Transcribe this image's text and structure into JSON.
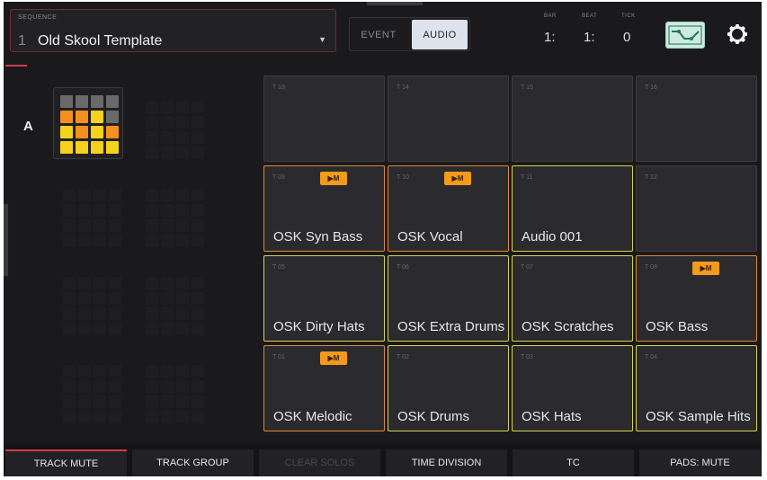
{
  "header": {
    "sequence_label": "SEQUENCE",
    "sequence_number": "1",
    "sequence_name": "Old Skool Template",
    "mode_event": "EVENT",
    "mode_audio": "AUDIO",
    "bar_label": "BAR",
    "bar_value": "1:",
    "beat_label": "BEAT",
    "beat_value": "1:",
    "tick_label": "TICK",
    "tick_value": "0"
  },
  "bank": {
    "label": "A",
    "cells": [
      "#6a6a6a",
      "#6a6a6a",
      "#6a6a6a",
      "#6a6a6a",
      "#f3901e",
      "#f3901e",
      "#f5d21c",
      "#6a6a6a",
      "#f5d21c",
      "#f3901e",
      "#f5d21c",
      "#f3901e",
      "#f5d21c",
      "#f5d21c",
      "#f5d21c",
      "#f5d21c"
    ]
  },
  "pads": [
    {
      "id": "T 13",
      "name": "",
      "border": "none",
      "badge": ""
    },
    {
      "id": "T 14",
      "name": "",
      "border": "none",
      "badge": ""
    },
    {
      "id": "T 15",
      "name": "",
      "border": "none",
      "badge": ""
    },
    {
      "id": "T 16",
      "name": "",
      "border": "none",
      "badge": ""
    },
    {
      "id": "T 09",
      "name": "OSK Syn Bass",
      "border": "orange",
      "badge": "▶M"
    },
    {
      "id": "T 10",
      "name": "OSK Vocal",
      "border": "orange",
      "badge": "▶M"
    },
    {
      "id": "T 11",
      "name": "Audio 001",
      "border": "yellow",
      "badge": ""
    },
    {
      "id": "T 12",
      "name": "",
      "border": "none",
      "badge": ""
    },
    {
      "id": "T 05",
      "name": "OSK Dirty Hats",
      "border": "yellow",
      "badge": ""
    },
    {
      "id": "T 06",
      "name": "OSK Extra Drums",
      "border": "yellow",
      "badge": ""
    },
    {
      "id": "T 07",
      "name": "OSK Scratches",
      "border": "yellow",
      "badge": ""
    },
    {
      "id": "T 08",
      "name": "OSK Bass",
      "border": "orange",
      "badge": "▶M"
    },
    {
      "id": "T 01",
      "name": "OSK Melodic",
      "border": "orange",
      "badge": "▶M"
    },
    {
      "id": "T 02",
      "name": "OSK Drums",
      "border": "yellow",
      "badge": ""
    },
    {
      "id": "T 03",
      "name": "OSK Hats",
      "border": "yellow",
      "badge": ""
    },
    {
      "id": "T 04",
      "name": "OSK Sample Hits",
      "border": "yellow",
      "badge": ""
    }
  ],
  "bottom": {
    "track_mute": "TRACK MUTE",
    "track_group": "TRACK GROUP",
    "clear_solos": "CLEAR SOLOS",
    "time_division": "TIME DIVISION",
    "tc": "TC",
    "pads_mute": "PADS: MUTE"
  },
  "colors": {
    "accent": "#d23a4c",
    "orange": "#f3901e",
    "yellow": "#d6d44b",
    "loop": "#cfe9e0"
  },
  "icons": {
    "loop": "loop-icon",
    "settings": "gear-icon",
    "dropdown": "chevron-down-icon"
  }
}
